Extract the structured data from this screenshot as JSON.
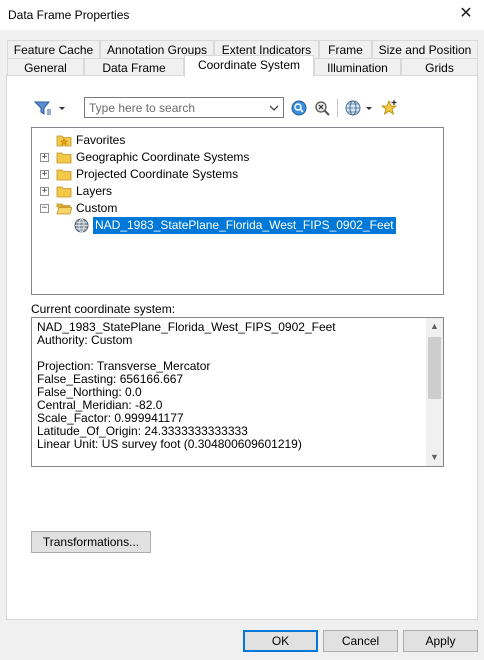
{
  "window": {
    "title": "Data Frame Properties",
    "close_glyph": "✕"
  },
  "tabs_row1": [
    {
      "label": "Feature Cache"
    },
    {
      "label": "Annotation Groups"
    },
    {
      "label": "Extent Indicators"
    },
    {
      "label": "Frame"
    },
    {
      "label": "Size and Position"
    }
  ],
  "tabs_row2": [
    {
      "label": "General"
    },
    {
      "label": "Data Frame"
    },
    {
      "label": "Coordinate System",
      "active": true
    },
    {
      "label": "Illumination"
    },
    {
      "label": "Grids"
    }
  ],
  "toolbar": {
    "filter_icon": "filter-icon",
    "search_placeholder": "Type here to search",
    "search_value": "",
    "search_go_icon": "search-go-icon",
    "clear_search_icon": "clear-search-icon",
    "globe_icon": "globe-icon",
    "add_favorite_icon": "add-favorite-icon"
  },
  "tree": {
    "items": [
      {
        "label": "Favorites",
        "expander": "",
        "icon": "favorites-folder-icon"
      },
      {
        "label": "Geographic Coordinate Systems",
        "expander": "+",
        "icon": "folder-icon"
      },
      {
        "label": "Projected Coordinate Systems",
        "expander": "+",
        "icon": "folder-icon"
      },
      {
        "label": "Layers",
        "expander": "+",
        "icon": "folder-icon"
      },
      {
        "label": "Custom",
        "expander": "−",
        "icon": "open-folder-icon"
      },
      {
        "label": "NAD_1983_StatePlane_Florida_West_FIPS_0902_Feet",
        "expander": "",
        "icon": "projection-globe-icon",
        "selected": true
      }
    ]
  },
  "current_cs": {
    "label": "Current coordinate system:",
    "lines": [
      "NAD_1983_StatePlane_Florida_West_FIPS_0902_Feet",
      "Authority: Custom",
      "",
      "Projection: Transverse_Mercator",
      "False_Easting: 656166.667",
      "False_Northing: 0.0",
      "Central_Meridian: -82.0",
      "Scale_Factor: 0.999941177",
      "Latitude_Of_Origin: 24.3333333333333",
      "Linear Unit: US survey foot (0.304800609601219)"
    ],
    "scroll_up": "▲",
    "scroll_down": "▼"
  },
  "buttons": {
    "transformations": "Transformations...",
    "ok": "OK",
    "cancel": "Cancel",
    "apply": "Apply"
  },
  "colors": {
    "selection": "#0078d7",
    "folder_yellow": "#f3c94a",
    "default_button_border": "#0078d7"
  }
}
